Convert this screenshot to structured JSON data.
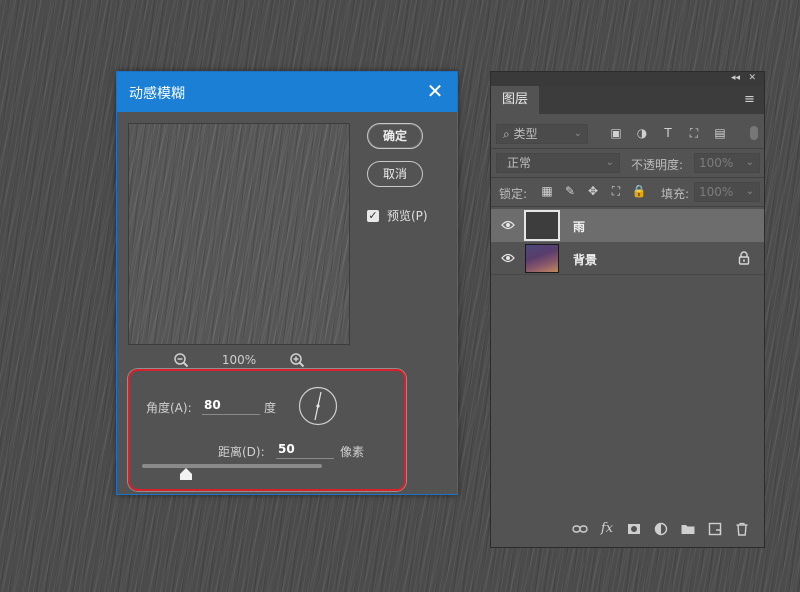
{
  "dialog": {
    "title": "动感模糊",
    "close_glyph": "✕",
    "ok_label": "确定",
    "cancel_label": "取消",
    "preview_label": "预览(P)",
    "preview_checked": true,
    "zoom_level": "100%",
    "angle_label": "角度(A):",
    "angle_value": "80",
    "angle_unit": "度",
    "distance_label": "距离(D):",
    "distance_value": "50",
    "distance_unit": "像素"
  },
  "layers_panel": {
    "collapse_glyph": "◂◂",
    "close_glyph": "✕",
    "tab_label": "图层",
    "menu_glyph": "≡",
    "filter_label": "类型",
    "filter_icon_glyphs": [
      "▣",
      "◑",
      "T",
      "⛶",
      "▤"
    ],
    "blend_mode": "正常",
    "opacity_label": "不透明度:",
    "opacity_value": "100%",
    "lock_label": "锁定:",
    "lock_icon_glyphs": [
      "▦",
      "✎",
      "✥",
      "⛶",
      "🔒"
    ],
    "fill_label": "填充:",
    "fill_value": "100%",
    "layers": [
      {
        "name": "雨",
        "selected": true,
        "visible": true,
        "locked": false
      },
      {
        "name": "背景",
        "selected": false,
        "visible": true,
        "locked": true
      }
    ],
    "bottom_icons": [
      "link-icon",
      "fx-icon",
      "mask-icon",
      "adjustment-icon",
      "folder-icon",
      "new-layer-icon",
      "trash-icon"
    ],
    "fx_label": "fx"
  },
  "colors": {
    "titlebar": "#1b7fd6",
    "highlight_border": "#d8202a",
    "panel_bg": "#535353",
    "selected_layer": "#6d6d6d"
  }
}
